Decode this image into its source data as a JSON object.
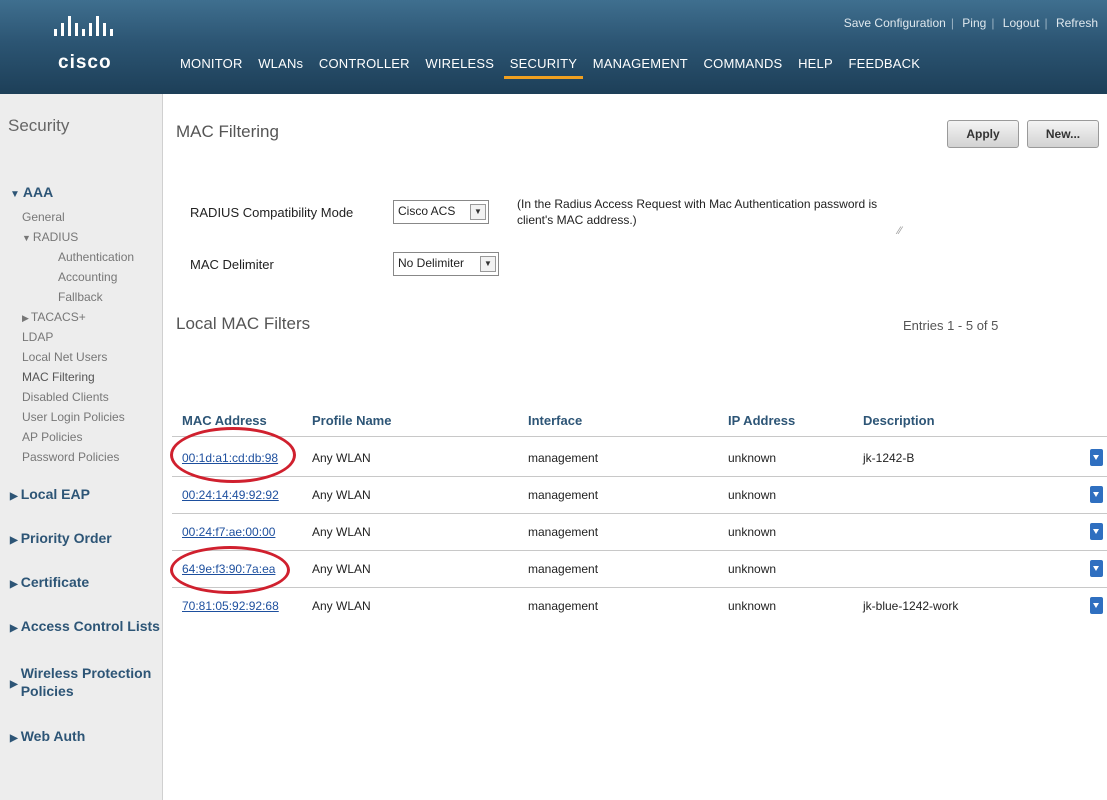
{
  "header": {
    "logo": "cisco",
    "top_links": [
      "Save Configuration",
      "Ping",
      "Logout",
      "Refresh"
    ],
    "nav": [
      "MONITOR",
      "WLANs",
      "CONTROLLER",
      "WIRELESS",
      "SECURITY",
      "MANAGEMENT",
      "COMMANDS",
      "HELP",
      "FEEDBACK"
    ],
    "active_nav": "SECURITY"
  },
  "sidebar": {
    "title": "Security",
    "aaa": "AAA",
    "aaa_items": [
      "General",
      "RADIUS",
      "Authentication",
      "Accounting",
      "Fallback",
      "TACACS+",
      "LDAP",
      "Local Net Users",
      "MAC Filtering",
      "Disabled Clients",
      "User Login Policies",
      "AP Policies",
      "Password Policies"
    ],
    "sections": [
      "Local EAP",
      "Priority Order",
      "Certificate",
      "Access Control Lists",
      "Wireless Protection",
      "Policies",
      "Web Auth"
    ]
  },
  "main": {
    "title": "MAC Filtering",
    "apply_label": "Apply",
    "new_label": "New...",
    "radius_label": "RADIUS Compatibility Mode",
    "radius_value": "Cisco ACS",
    "delimiter_label": "MAC Delimiter",
    "delimiter_value": "No Delimiter",
    "note": "(In the Radius Access Request with Mac Authentication password is client's MAC address.)",
    "local_filters_title": "Local MAC Filters",
    "entries": "Entries 1 - 5 of 5"
  },
  "table": {
    "headers": [
      "MAC Address",
      "Profile Name",
      "Interface",
      "IP Address",
      "Description"
    ],
    "rows": [
      {
        "mac": "00:1d:a1:cd:db:98",
        "profile": "Any WLAN",
        "interface": "management",
        "ip": "unknown",
        "description": "jk-1242-B"
      },
      {
        "mac": "00:24:14:49:92:92",
        "profile": "Any WLAN",
        "interface": "management",
        "ip": "unknown",
        "description": ""
      },
      {
        "mac": "00:24:f7:ae:00:00",
        "profile": "Any WLAN",
        "interface": "management",
        "ip": "unknown",
        "description": ""
      },
      {
        "mac": "64:9e:f3:90:7a:ea",
        "profile": "Any WLAN",
        "interface": "management",
        "ip": "unknown",
        "description": ""
      },
      {
        "mac": "70:81:05:92:92:68",
        "profile": "Any WLAN",
        "interface": "management",
        "ip": "unknown",
        "description": "jk-blue-1242-work"
      }
    ]
  },
  "colors": {
    "header_bg": "#2c5573",
    "active_underline": "#f0a020",
    "section_blue": "#2d5576",
    "highlight_circle": "#d0202e"
  }
}
